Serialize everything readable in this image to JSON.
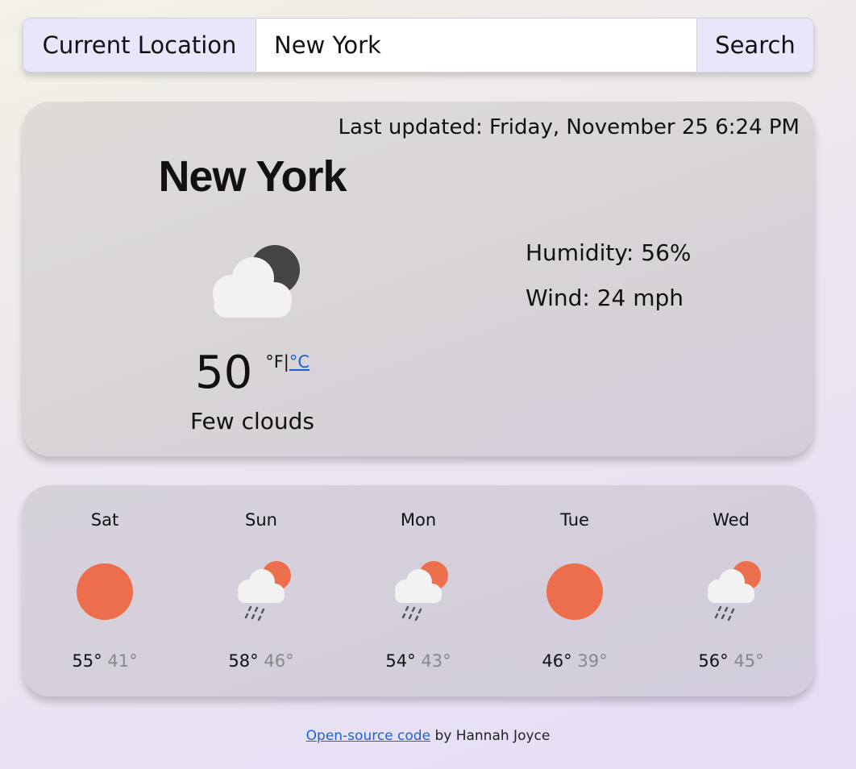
{
  "search": {
    "location_button": "Current Location",
    "input_value": "New York",
    "placeholder": "",
    "search_button": "Search"
  },
  "current": {
    "last_updated": "Last updated: Friday, November 25 6:24 PM",
    "city": "New York",
    "icon": "few-clouds-night-icon",
    "temperature": "50",
    "unit_f": "°F",
    "unit_separator": "|",
    "unit_c": "°C",
    "description": "Few clouds",
    "humidity": "Humidity: 56%",
    "wind": "Wind: 24 mph"
  },
  "forecast": [
    {
      "day": "Sat",
      "icon": "sun-icon",
      "high": "55°",
      "low": "41°"
    },
    {
      "day": "Sun",
      "icon": "rain-sun-icon",
      "high": "58°",
      "low": "46°"
    },
    {
      "day": "Mon",
      "icon": "rain-sun-icon",
      "high": "54°",
      "low": "43°"
    },
    {
      "day": "Tue",
      "icon": "sun-icon",
      "high": "46°",
      "low": "39°"
    },
    {
      "day": "Wed",
      "icon": "rain-sun-icon",
      "high": "56°",
      "low": "45°"
    }
  ],
  "footer": {
    "link_text": "Open-source code",
    "by_text": " by Hannah Joyce"
  },
  "colors": {
    "sun": "#ec6e4c",
    "moon": "#444444",
    "cloud": "#f2f2f2",
    "link": "#1a63d6",
    "button_bg": "#ebe5fb"
  }
}
